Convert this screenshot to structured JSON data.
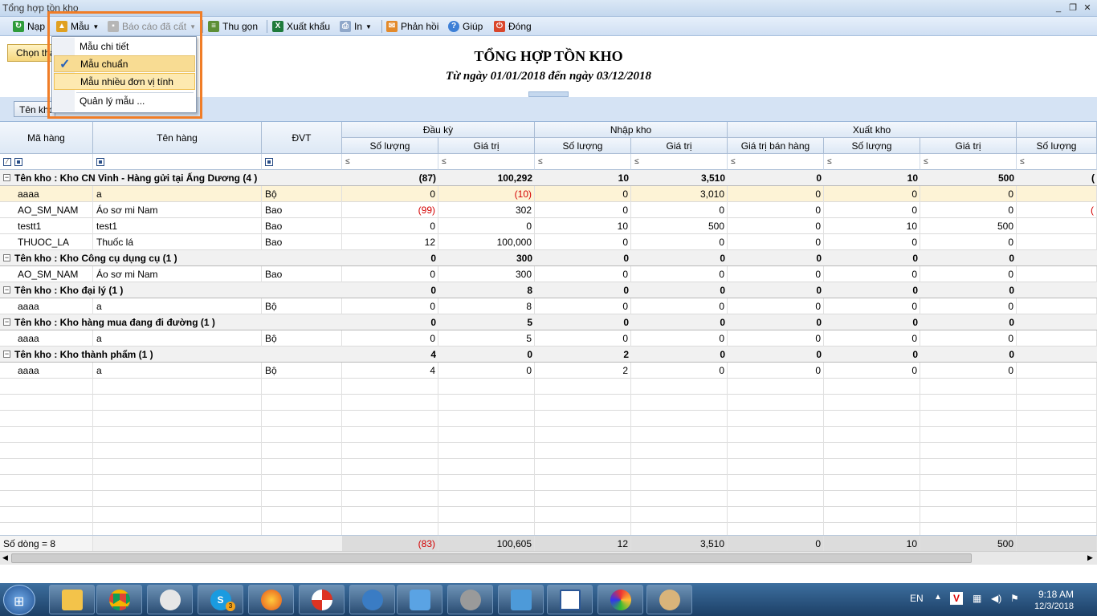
{
  "window": {
    "title": "Tổng hợp tồn kho"
  },
  "toolbar": {
    "reload": "Nạp",
    "template": "Mẫu",
    "saved_report": "Báo cáo đã cất",
    "collapse": "Thu gọn",
    "export": "Xuất khẩu",
    "print": "In",
    "feedback": "Phản hồi",
    "help": "Giúp",
    "close": "Đóng"
  },
  "template_menu": {
    "items": [
      {
        "label": "Mẫu chi tiết"
      },
      {
        "label": "Mẫu chuẩn",
        "checked": true
      },
      {
        "label": "Mẫu nhiều đơn vị tính"
      },
      {
        "label": "Quản lý mẫu ..."
      }
    ]
  },
  "choose_button": "Chọn tham số",
  "report": {
    "title": "TỔNG HỢP TỒN KHO",
    "subtitle": "Từ ngày 01/01/2018 đến ngày 03/12/2018"
  },
  "group_chip": "Tên kho",
  "grid": {
    "columns": {
      "ma_hang": "Mã hàng",
      "ten_hang": "Tên hàng",
      "dvt": "ĐVT",
      "dau_ky": "Đầu kỳ",
      "nhap_kho": "Nhập kho",
      "xuat_kho": "Xuất kho",
      "so_luong": "Số lượng",
      "gia_tri": "Giá trị",
      "gia_tri_ban_hang": "Giá trị bán hàng",
      "filter_symbol": "≤"
    },
    "groups": [
      {
        "label": "Tên kho : Kho CN Vinh - Hàng gửi tại Ấng Dương (4 )",
        "totals": [
          "(87)",
          "100,292",
          "10",
          "3,510",
          "0",
          "10",
          "500",
          "("
        ],
        "rows": [
          {
            "ma": "aaaa",
            "ten": "a",
            "dvt": "Bộ",
            "v": [
              "0",
              "(10)",
              "0",
              "3,010",
              "0",
              "0",
              "0",
              ""
            ],
            "highlight": true
          },
          {
            "ma": "AO_SM_NAM",
            "ten": "Áo sơ mi Nam",
            "dvt": "Bao",
            "v": [
              "(99)",
              "302",
              "0",
              "0",
              "0",
              "0",
              "0",
              "("
            ]
          },
          {
            "ma": "testt1",
            "ten": "test1",
            "dvt": "Bao",
            "v": [
              "0",
              "0",
              "10",
              "500",
              "0",
              "10",
              "500",
              ""
            ]
          },
          {
            "ma": "THUOC_LA",
            "ten": "Thuốc lá",
            "dvt": "Bao",
            "v": [
              "12",
              "100,000",
              "0",
              "0",
              "0",
              "0",
              "0",
              ""
            ]
          }
        ]
      },
      {
        "label": "Tên kho : Kho Công cụ dụng cụ (1 )",
        "totals": [
          "0",
          "300",
          "0",
          "0",
          "0",
          "0",
          "0",
          ""
        ],
        "rows": [
          {
            "ma": "AO_SM_NAM",
            "ten": "Áo sơ mi Nam",
            "dvt": "Bao",
            "v": [
              "0",
              "300",
              "0",
              "0",
              "0",
              "0",
              "0",
              ""
            ]
          }
        ]
      },
      {
        "label": "Tên kho : Kho đại lý (1 )",
        "totals": [
          "0",
          "8",
          "0",
          "0",
          "0",
          "0",
          "0",
          ""
        ],
        "rows": [
          {
            "ma": "aaaa",
            "ten": "a",
            "dvt": "Bộ",
            "v": [
              "0",
              "8",
              "0",
              "0",
              "0",
              "0",
              "0",
              ""
            ]
          }
        ]
      },
      {
        "label": "Tên kho : Kho hàng mua đang đi đường (1 )",
        "totals": [
          "0",
          "5",
          "0",
          "0",
          "0",
          "0",
          "0",
          ""
        ],
        "rows": [
          {
            "ma": "aaaa",
            "ten": "a",
            "dvt": "Bộ",
            "v": [
              "0",
              "5",
              "0",
              "0",
              "0",
              "0",
              "0",
              ""
            ]
          }
        ]
      },
      {
        "label": "Tên kho : Kho thành phẩm (1 )",
        "totals": [
          "4",
          "0",
          "2",
          "0",
          "0",
          "0",
          "0",
          ""
        ],
        "rows": [
          {
            "ma": "aaaa",
            "ten": "a",
            "dvt": "Bộ",
            "v": [
              "4",
              "0",
              "2",
              "0",
              "0",
              "0",
              "0",
              ""
            ]
          }
        ]
      }
    ],
    "footer": {
      "count": "Số dòng = 8",
      "values": [
        "(83)",
        "100,605",
        "12",
        "3,510",
        "0",
        "10",
        "500",
        ""
      ]
    }
  },
  "taskbar": {
    "lang": "EN",
    "time": "9:18 AM",
    "date": "12/3/2018",
    "skype_badge": "3"
  }
}
